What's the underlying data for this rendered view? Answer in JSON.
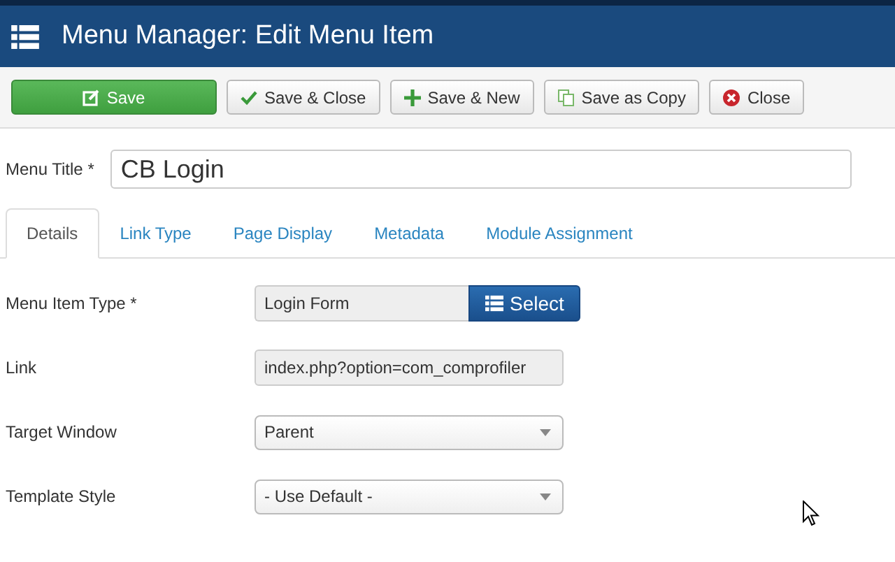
{
  "header": {
    "title": "Menu Manager: Edit Menu Item"
  },
  "toolbar": [
    {
      "kind": "save",
      "label": "Save"
    },
    {
      "kind": "check",
      "label": "Save & Close"
    },
    {
      "kind": "plus",
      "label": "Save & New"
    },
    {
      "kind": "copy",
      "label": "Save as Copy"
    },
    {
      "kind": "close",
      "label": "Close"
    }
  ],
  "menu_title": {
    "label": "Menu Title *",
    "value": "CB Login"
  },
  "tabs": [
    {
      "label": "Details",
      "selected": true
    },
    {
      "label": "Link Type",
      "selected": false
    },
    {
      "label": "Page Display",
      "selected": false
    },
    {
      "label": "Metadata",
      "selected": false
    },
    {
      "label": "Module Assignment",
      "selected": false
    }
  ],
  "fields": [
    {
      "kind": "picker",
      "label": "Menu Item Type *",
      "value": "Login Form",
      "button": "Select"
    },
    {
      "kind": "readonly",
      "label": "Link",
      "value": "index.php?option=com_comprofiler"
    },
    {
      "kind": "select",
      "label": "Target Window",
      "value": "Parent"
    },
    {
      "kind": "select",
      "label": "Template Style",
      "value": "- Use Default -"
    }
  ]
}
